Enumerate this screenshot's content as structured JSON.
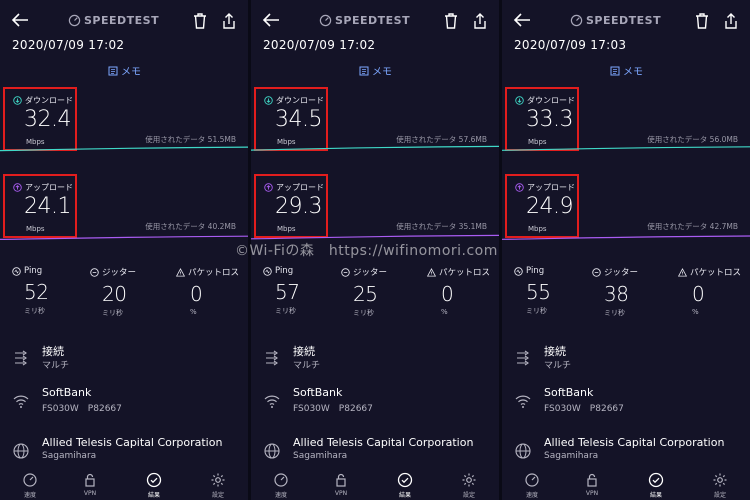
{
  "watermark": "©Wi-Fiの森　https://wifinomori.com",
  "labels": {
    "brand": "SPEEDTEST",
    "memo": "メモ",
    "download": "ダウンロード",
    "upload": "アップロード",
    "mbps": "Mbps",
    "used_data": "使用されたデータ",
    "ping": "Ping",
    "jitter": "ジッター",
    "packet_loss": "パケットロス",
    "ms": "ミリ秒",
    "percent": "%",
    "connection": "接続",
    "connection_value": "マルチ",
    "nav_speed": "速度",
    "nav_vpn": "VPN",
    "nav_results": "結果",
    "nav_settings": "設定"
  },
  "colors": {
    "download_line": "#3fd8c7",
    "upload_line": "#a95cf2",
    "highlight": "#e21d1d",
    "memo": "#7da7ff"
  },
  "panels": [
    {
      "datetime": "2020/07/09 17:02",
      "download": {
        "value": "32.4",
        "used": "51.5MB",
        "level": 0.62
      },
      "upload": {
        "value": "24.1",
        "used": "40.2MB",
        "level": 0.55
      },
      "ping": "52",
      "jitter": "20",
      "loss": "0",
      "isp_name": "SoftBank",
      "isp_device": "FS030W　P82667",
      "server_name": "Allied Telesis Capital Corporation",
      "server_city": "Sagamihara"
    },
    {
      "datetime": "2020/07/09 17:02",
      "download": {
        "value": "34.5",
        "used": "57.6MB",
        "level": 0.66
      },
      "upload": {
        "value": "29.3",
        "used": "35.1MB",
        "level": 0.6
      },
      "ping": "57",
      "jitter": "25",
      "loss": "0",
      "isp_name": "SoftBank",
      "isp_device": "FS030W　P82667",
      "server_name": "Allied Telesis Capital Corporation",
      "server_city": "Sagamihara"
    },
    {
      "datetime": "2020/07/09 17:03",
      "download": {
        "value": "33.3",
        "used": "56.0MB",
        "level": 0.64
      },
      "upload": {
        "value": "24.9",
        "used": "42.7MB",
        "level": 0.56
      },
      "ping": "55",
      "jitter": "38",
      "loss": "0",
      "isp_name": "SoftBank",
      "isp_device": "FS030W　P82667",
      "server_name": "Allied Telesis Capital Corporation",
      "server_city": "Sagamihara"
    }
  ]
}
